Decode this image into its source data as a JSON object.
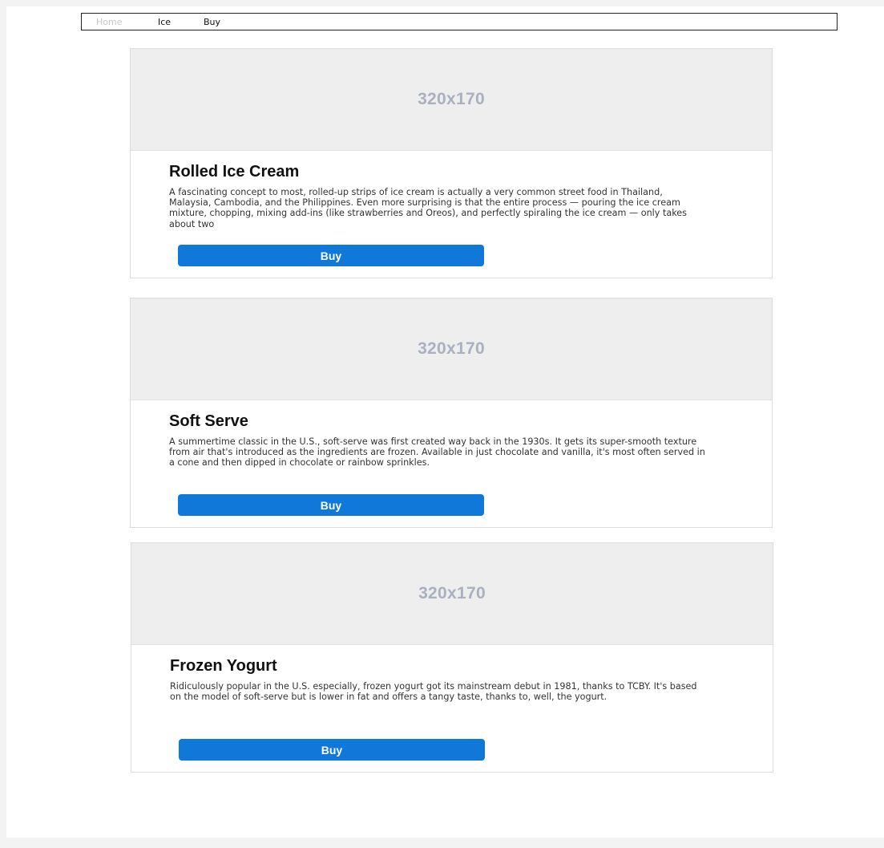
{
  "nav": {
    "items": [
      {
        "label": "Home"
      },
      {
        "label": "Ice"
      },
      {
        "label": "Buy"
      }
    ]
  },
  "cards": [
    {
      "image_label": "320x170",
      "title": "Rolled Ice Cream",
      "description": "A fascinating concept to most, rolled-up strips of ice cream is actually a very common street food in Thailand, Malaysia, Cambodia, and the Philippines. Even more surprising is that the entire process — pouring the ice cream mixture, chopping, mixing add-ins (like strawberries and Oreos), and perfectly spiraling the ice cream — only takes about two",
      "button_label": "Buy"
    },
    {
      "image_label": "320x170",
      "title": "Soft Serve",
      "description": "A summertime classic in the U.S., soft-serve was first created way back in the 1930s. It gets its super-smooth texture from air that's introduced as the ingredients are frozen. Available in just chocolate and vanilla, it's most often served in a cone and then dipped in chocolate or rainbow sprinkles.",
      "button_label": "Buy"
    },
    {
      "image_label": "320x170",
      "title": "Frozen Yogurt",
      "description": "Ridiculously popular in the U.S. especially, frozen yogurt got its mainstream debut in 1981, thanks to TCBY. It's based on the model of soft-serve but is lower in fat and offers a tangy taste, thanks to, well, the yogurt.",
      "button_label": "Buy"
    }
  ]
}
